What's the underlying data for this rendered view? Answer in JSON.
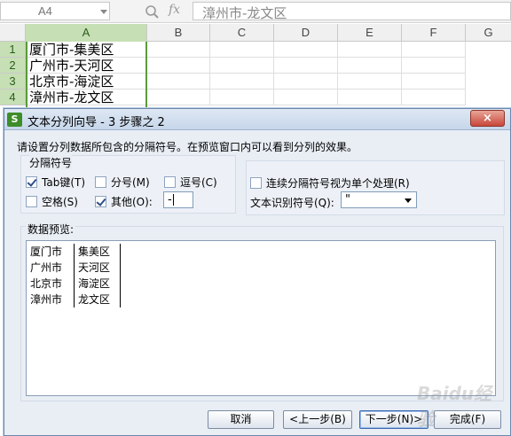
{
  "formula_bar": {
    "cell_ref": "A4",
    "fx": "fx",
    "formula": "漳州市-龙文区"
  },
  "columns": [
    "A",
    "B",
    "C",
    "D",
    "E",
    "F",
    "G"
  ],
  "rows": [
    {
      "num": "1",
      "a": "厦门市-集美区"
    },
    {
      "num": "2",
      "a": "广州市-天河区"
    },
    {
      "num": "3",
      "a": "北京市-海淀区"
    },
    {
      "num": "4",
      "a": "漳州市-龙文区"
    }
  ],
  "dialog": {
    "icon": "S",
    "title": "文本分列向导 - 3 步骤之 2",
    "close": "×",
    "instruction": "请设置分列数据所包含的分隔符号。在预览窗口内可以看到分列的效果。",
    "delimiters_label": "分隔符号",
    "tab": {
      "label": "Tab键(T)",
      "checked": true
    },
    "semicolon": {
      "label": "分号(M)",
      "checked": false
    },
    "comma": {
      "label": "逗号(C)",
      "checked": false
    },
    "space": {
      "label": "空格(S)",
      "checked": false
    },
    "other": {
      "label": "其他(O):",
      "checked": true,
      "value": "-"
    },
    "consecutive": {
      "label": "连续分隔符号视为单个处理(R)",
      "checked": false
    },
    "text_qualifier": {
      "label": "文本识别符号(Q):",
      "value": "\""
    },
    "preview_label": "数据预览:",
    "preview_rows": [
      [
        "厦门市",
        "集美区"
      ],
      [
        "广州市",
        "天河区"
      ],
      [
        "北京市",
        "海淀区"
      ],
      [
        "漳州市",
        "龙文区"
      ]
    ],
    "buttons": {
      "cancel": "取消",
      "back": "<上一步(B)",
      "next": "下一步(N)>",
      "finish": "完成(F)"
    }
  },
  "watermark": "Baidu经验",
  "colors": {
    "selection": "#5a9b38",
    "dialog_bg": "#e9eef5",
    "close": "#c8473a"
  }
}
